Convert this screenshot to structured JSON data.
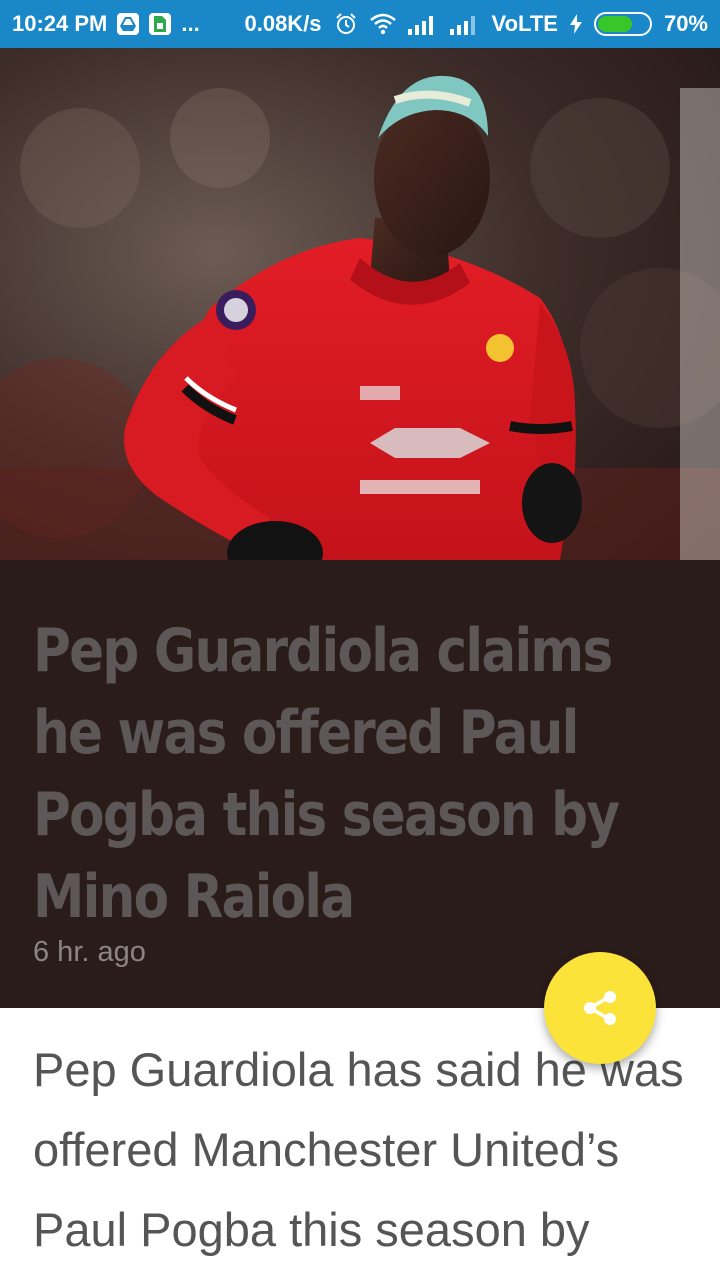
{
  "status_bar": {
    "time": "10:24 PM",
    "more": "...",
    "net_speed": "0.08K/s",
    "network": "VoLTE",
    "battery_percent": "70%",
    "battery_level": 0.7,
    "icons": [
      "drive-icon",
      "sim-icon",
      "alarm-icon",
      "wifi-icon",
      "signal-icon",
      "signal-icon",
      "charging-icon",
      "battery-icon"
    ]
  },
  "article": {
    "hero_image": "player-photo",
    "headline": "Pep Guardiola claims he was offered Paul Pogba this season by Mino Raiola",
    "time_ago": "6 hr. ago",
    "body": "Pep Guardiola has said he was offered Manchester United’s Paul Pogba this season by"
  },
  "fab": {
    "icon": "share-icon"
  },
  "colors": {
    "status_bar": "#1a88c8",
    "headline_panel": "#2b1c1c",
    "headline_text": "#5e5757",
    "fab": "#fbe33a",
    "jersey": "#d9161f"
  }
}
